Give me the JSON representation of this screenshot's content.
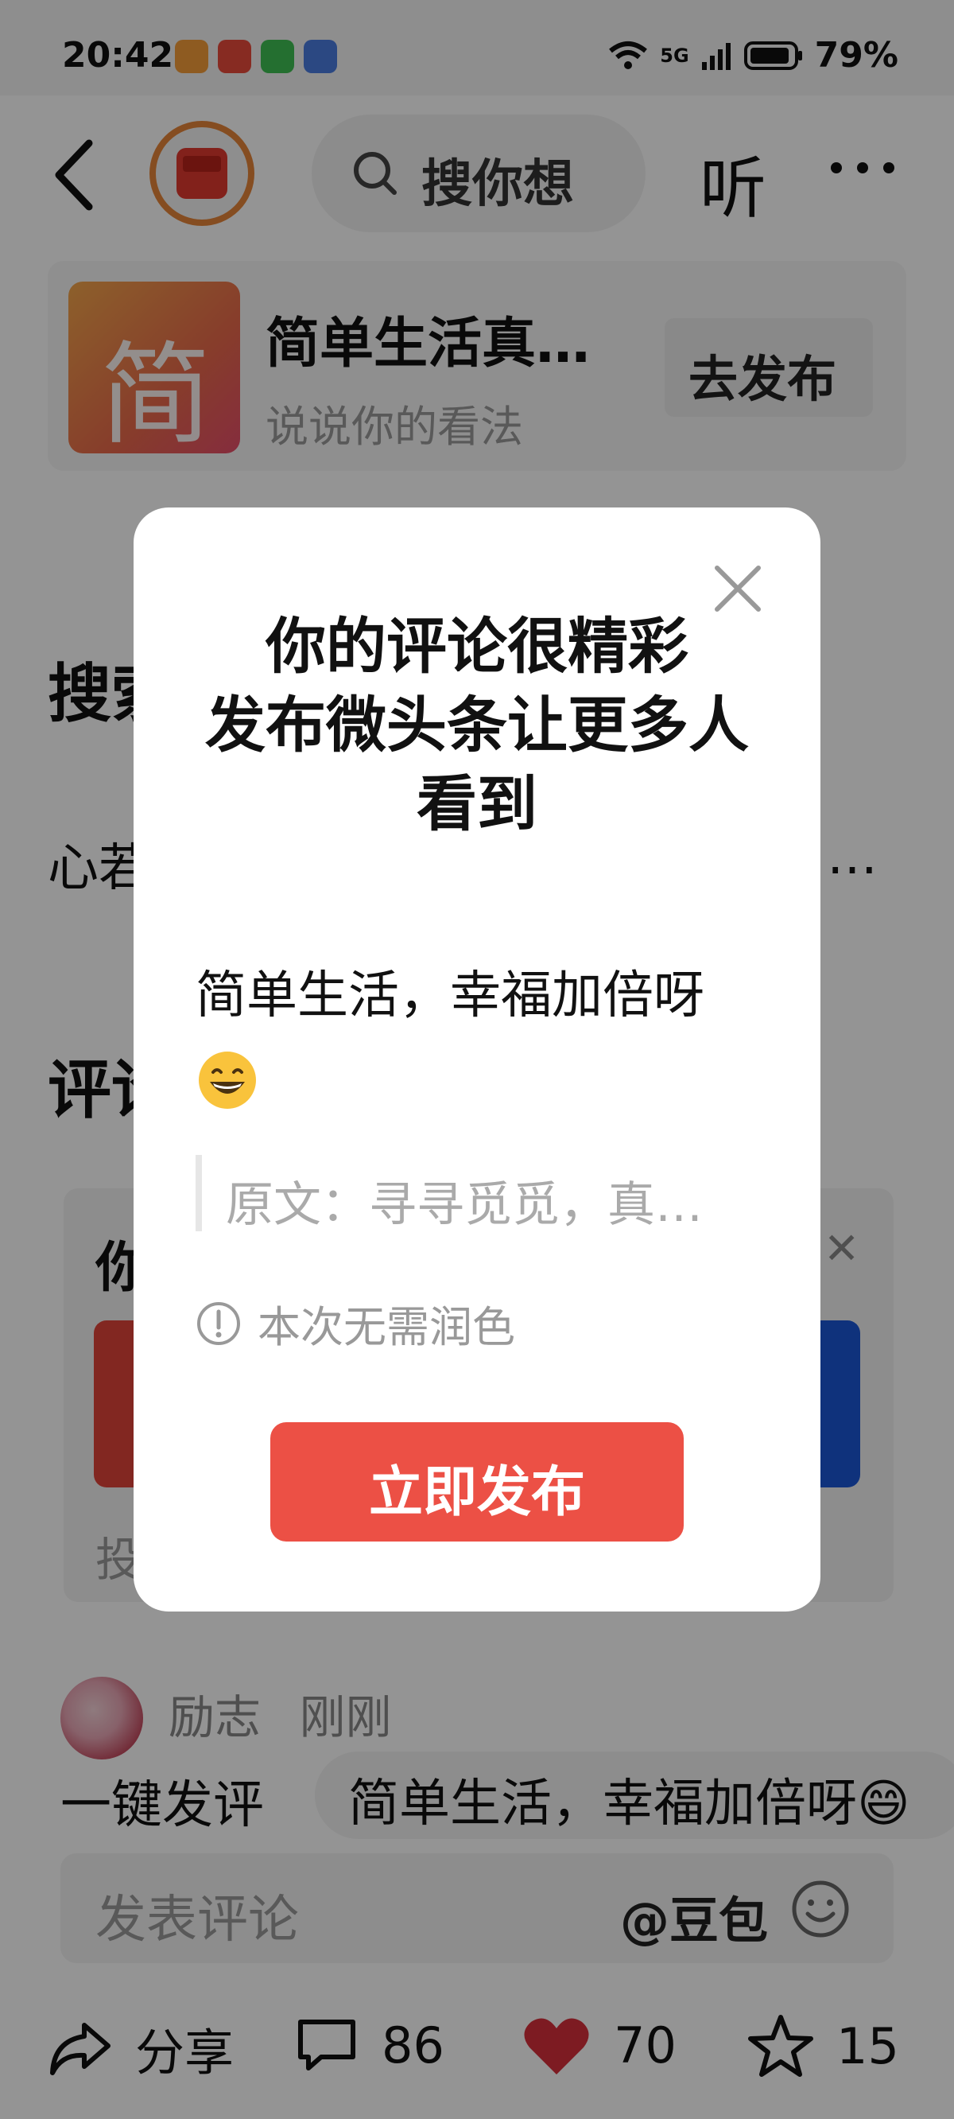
{
  "status_bar": {
    "time": "20:42",
    "network": "5G",
    "battery": "79%"
  },
  "header": {
    "search_placeholder": "搜你想",
    "listen_label": "听"
  },
  "article": {
    "thumb_char": "简",
    "title": "简单生活真…",
    "subtitle": "说说你的看法",
    "publish_label": "去发布"
  },
  "background": {
    "section1_partial": "搜索",
    "line1_start": "心若",
    "line1_end": "…",
    "section2_partial": "评论",
    "promo_partial": "你",
    "promo_footer_partial": "投"
  },
  "comment": {
    "author": "励志",
    "time": "刚刚",
    "quick_label": "一键发评",
    "quick_suggestion": "简单生活，幸福加倍呀😄",
    "input_placeholder": "发表评论",
    "mention": "@豆包"
  },
  "bottom_bar": {
    "share_label": "分享",
    "comments_count": "86",
    "likes_count": "70",
    "favorites_count": "15"
  },
  "modal": {
    "title_lines": [
      "你的评论很精彩",
      "发布微头条让更多人",
      "看到"
    ],
    "comment_text": "简单生活，幸福加倍呀",
    "original_label": "原文：寻寻觅觅，真…",
    "hint": "本次无需润色",
    "cta_label": "立即发布"
  },
  "colors": {
    "accent_red": "#ec5045",
    "like_red": "#d8303c"
  }
}
